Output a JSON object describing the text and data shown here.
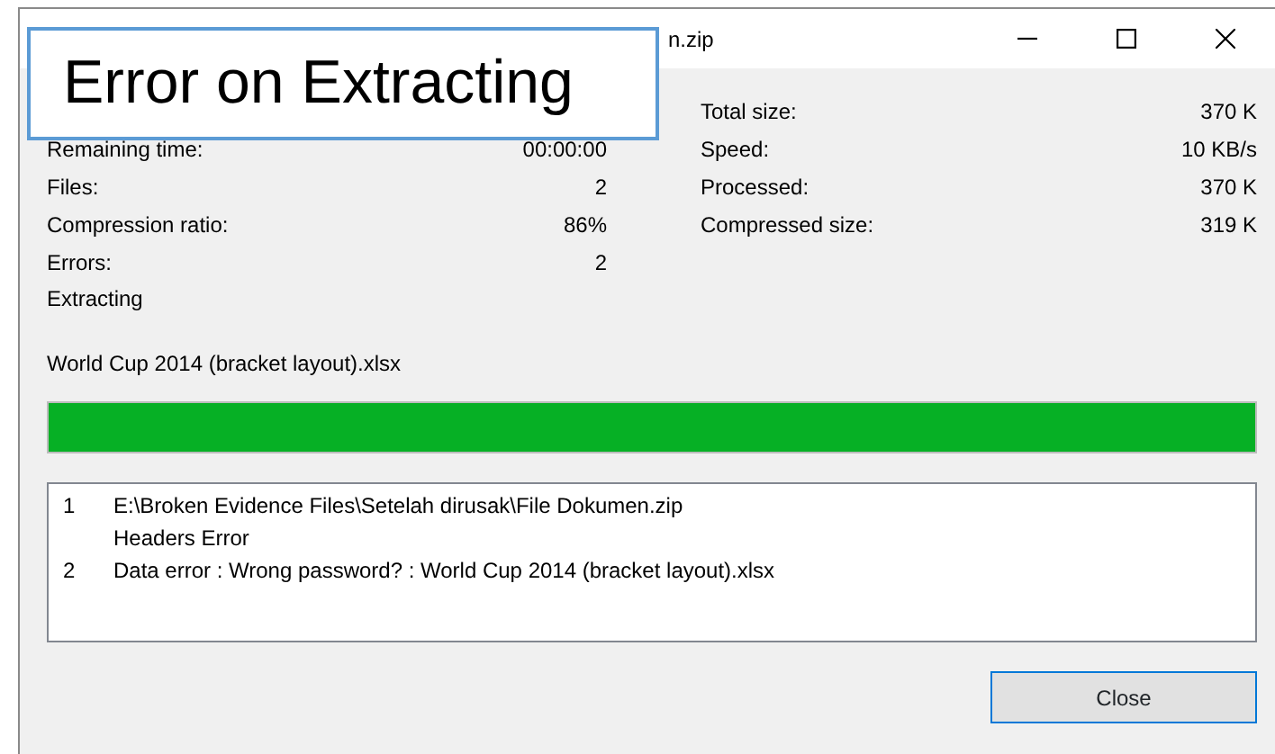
{
  "window": {
    "title": "n.zip"
  },
  "callout": {
    "text": "Error on Extracting"
  },
  "stats_left": [
    {
      "label": "Remaining time:",
      "value": "00:00:00"
    },
    {
      "label": "Files:",
      "value": "2"
    },
    {
      "label": "Compression ratio:",
      "value": "86%"
    },
    {
      "label": "Errors:",
      "value": "2"
    }
  ],
  "stats_right": [
    {
      "label": "Total size:",
      "value": "370 K"
    },
    {
      "label": "Speed:",
      "value": "10 KB/s"
    },
    {
      "label": "Processed:",
      "value": "370 K"
    },
    {
      "label": "Compressed size:",
      "value": "319 K"
    }
  ],
  "operation": "Extracting",
  "current_file": "World Cup 2014 (bracket layout).xlsx",
  "progress": {
    "level": 1
  },
  "log": [
    {
      "number": "1",
      "lines": [
        "E:\\Broken Evidence Files\\Setelah dirusak\\File Dokumen.zip",
        "Headers Error"
      ]
    },
    {
      "number": "2",
      "lines": [
        "Data error : Wrong password? : World Cup 2014 (bracket layout).xlsx"
      ]
    }
  ],
  "buttons": [
    "Close"
  ]
}
